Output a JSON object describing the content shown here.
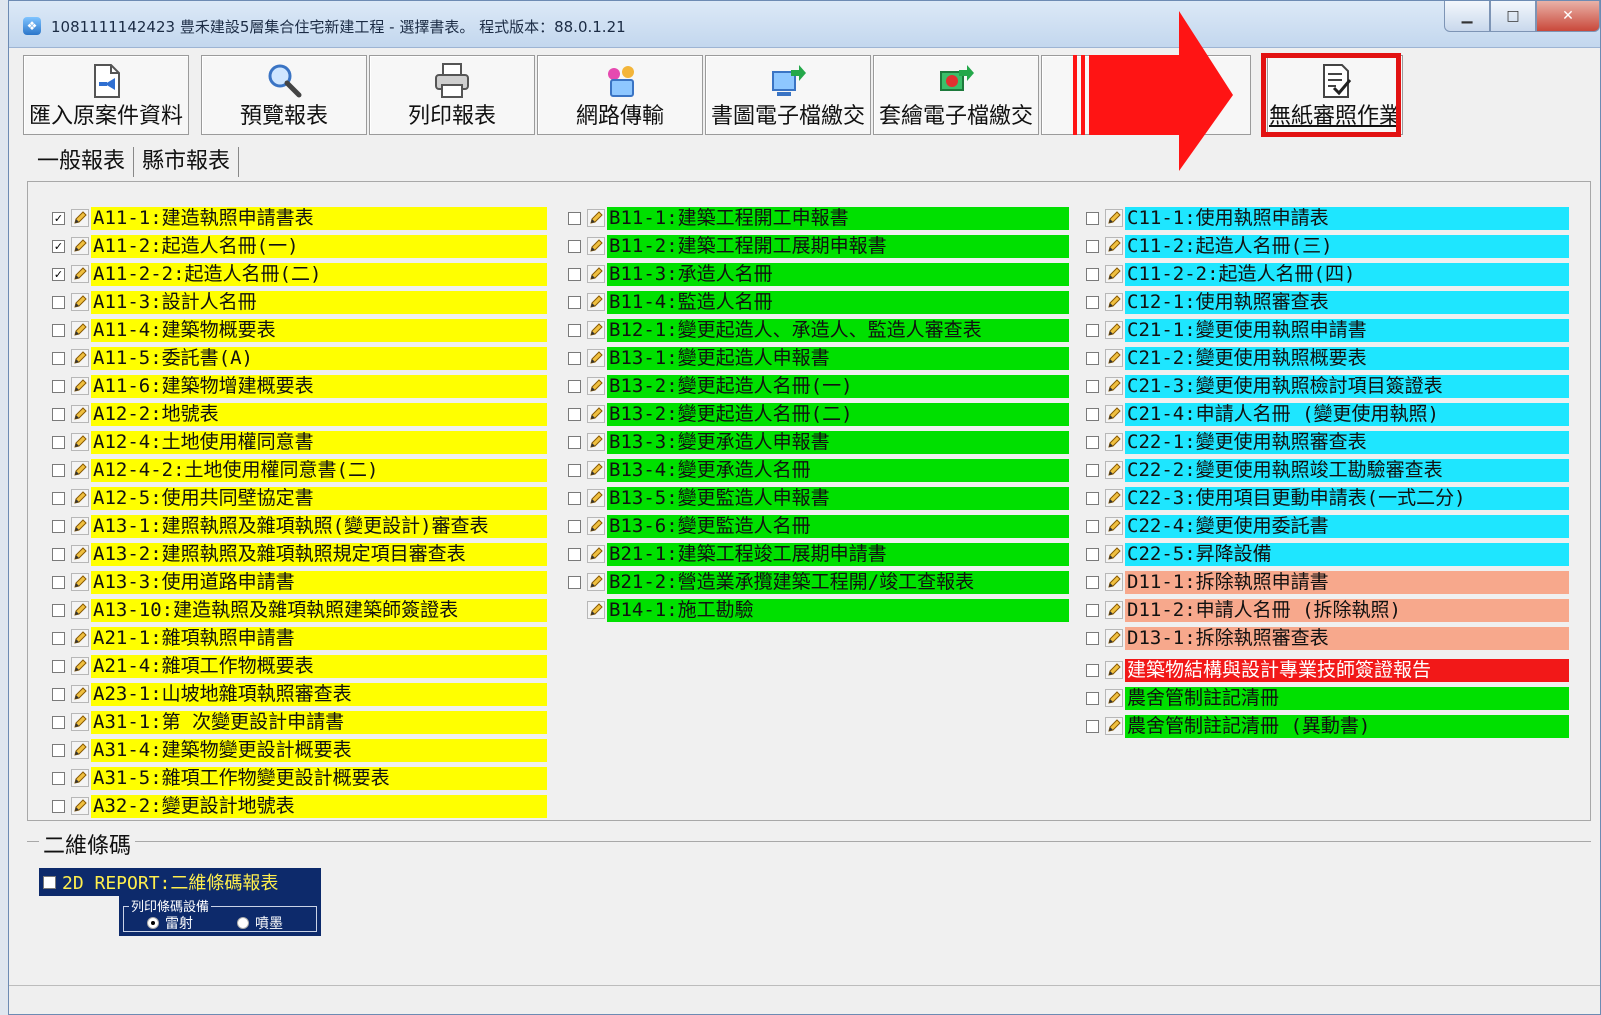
{
  "window": {
    "title": "1081111142423 豊禾建設5層集合住宅新建工程 - 選擇書表。   程式版本：88.0.1.21",
    "minimize": "▁",
    "maximize": "□",
    "close": "✕"
  },
  "toolbar": [
    {
      "label": "匯入原案件資料",
      "icon": "import-icon"
    },
    {
      "label": "預覽報表",
      "icon": "magnifier-icon"
    },
    {
      "label": "列印報表",
      "icon": "printer-icon"
    },
    {
      "label": "網路傳輸",
      "icon": "network-icon"
    },
    {
      "label": "書圖電子檔繳交",
      "icon": "upload-icon"
    },
    {
      "label": "套繪電子檔繳交",
      "icon": "upload-red-icon"
    },
    {
      "label": "無紙審照作業",
      "icon": "paper-check-icon"
    }
  ],
  "tabs": [
    "一般報表",
    "縣市報表"
  ],
  "colors": {
    "yellow": "#ffff00",
    "green": "#00e000",
    "cyan": "#1ee6ff",
    "salmon": "#f7a88c",
    "red": "#f21818",
    "highlight_red": "#e21212"
  },
  "columns": [
    [
      {
        "text": "A11-1:建造執照申請書表",
        "checked": true,
        "color": "#ffff00"
      },
      {
        "text": "A11-2:起造人名冊(一)",
        "checked": true,
        "color": "#ffff00"
      },
      {
        "text": "A11-2-2:起造人名冊(二)",
        "checked": true,
        "color": "#ffff00"
      },
      {
        "text": "A11-3:設計人名冊",
        "checked": false,
        "color": "#ffff00"
      },
      {
        "text": "A11-4:建築物概要表",
        "checked": false,
        "color": "#ffff00"
      },
      {
        "text": "A11-5:委託書(A)",
        "checked": false,
        "color": "#ffff00"
      },
      {
        "text": "A11-6:建築物增建概要表",
        "checked": false,
        "color": "#ffff00"
      },
      {
        "text": "A12-2:地號表",
        "checked": false,
        "color": "#ffff00"
      },
      {
        "text": "A12-4:土地使用權同意書",
        "checked": false,
        "color": "#ffff00"
      },
      {
        "text": "A12-4-2:土地使用權同意書(二)",
        "checked": false,
        "color": "#ffff00"
      },
      {
        "text": "A12-5:使用共同壁協定書",
        "checked": false,
        "color": "#ffff00"
      },
      {
        "text": "A13-1:建照執照及雜項執照(變更設計)審查表",
        "checked": false,
        "color": "#ffff00"
      },
      {
        "text": "A13-2:建照執照及雜項執照規定項目審查表",
        "checked": false,
        "color": "#ffff00"
      },
      {
        "text": "A13-3:使用道路申請書",
        "checked": false,
        "color": "#ffff00"
      },
      {
        "text": "A13-10:建造執照及雜項執照建築師簽證表",
        "checked": false,
        "color": "#ffff00"
      },
      {
        "text": "A21-1:雜項執照申請書",
        "checked": false,
        "color": "#ffff00"
      },
      {
        "text": "A21-4:雜項工作物概要表",
        "checked": false,
        "color": "#ffff00"
      },
      {
        "text": "A23-1:山坡地雜項執照審查表",
        "checked": false,
        "color": "#ffff00"
      },
      {
        "text": "A31-1:第 次變更設計申請書",
        "checked": false,
        "color": "#ffff00"
      },
      {
        "text": "A31-4:建築物變更設計概要表",
        "checked": false,
        "color": "#ffff00"
      },
      {
        "text": "A31-5:雜項工作物變更設計概要表",
        "checked": false,
        "color": "#ffff00"
      },
      {
        "text": "A32-2:變更設計地號表",
        "checked": false,
        "color": "#ffff00"
      }
    ],
    [
      {
        "text": "B11-1:建築工程開工申報書",
        "checked": false,
        "color": "#00e000"
      },
      {
        "text": "B11-2:建築工程開工展期申報書",
        "checked": false,
        "color": "#00e000"
      },
      {
        "text": "B11-3:承造人名冊",
        "checked": false,
        "color": "#00e000"
      },
      {
        "text": "B11-4:監造人名冊",
        "checked": false,
        "color": "#00e000"
      },
      {
        "text": "B12-1:變更起造人、承造人、監造人審查表",
        "checked": false,
        "color": "#00e000"
      },
      {
        "text": "B13-1:變更起造人申報書",
        "checked": false,
        "color": "#00e000"
      },
      {
        "text": "B13-2:變更起造人名冊(一)",
        "checked": false,
        "color": "#00e000"
      },
      {
        "text": "B13-2:變更起造人名冊(二)",
        "checked": false,
        "color": "#00e000"
      },
      {
        "text": "B13-3:變更承造人申報書",
        "checked": false,
        "color": "#00e000"
      },
      {
        "text": "B13-4:變更承造人名冊",
        "checked": false,
        "color": "#00e000"
      },
      {
        "text": "B13-5:變更監造人申報書",
        "checked": false,
        "color": "#00e000"
      },
      {
        "text": "B13-6:變更監造人名冊",
        "checked": false,
        "color": "#00e000"
      },
      {
        "text": "B21-1:建築工程竣工展期申請書",
        "checked": false,
        "color": "#00e000"
      },
      {
        "text": "B21-2:營造業承攬建築工程開/竣工查報表",
        "checked": false,
        "color": "#00e000"
      },
      {
        "text": "B14-1:施工勘驗",
        "checked": null,
        "color": "#00e000"
      }
    ],
    [
      {
        "text": "C11-1:使用執照申請表",
        "checked": false,
        "color": "#1ee6ff"
      },
      {
        "text": "C11-2:起造人名冊(三)",
        "checked": false,
        "color": "#1ee6ff"
      },
      {
        "text": "C11-2-2:起造人名冊(四)",
        "checked": false,
        "color": "#1ee6ff"
      },
      {
        "text": "C12-1:使用執照審查表",
        "checked": false,
        "color": "#1ee6ff"
      },
      {
        "text": "C21-1:變更使用執照申請書",
        "checked": false,
        "color": "#1ee6ff"
      },
      {
        "text": "C21-2:變更使用執照概要表",
        "checked": false,
        "color": "#1ee6ff"
      },
      {
        "text": "C21-3:變更使用執照檢討項目簽證表",
        "checked": false,
        "color": "#1ee6ff"
      },
      {
        "text": "C21-4:申請人名冊 (變更使用執照)",
        "checked": false,
        "color": "#1ee6ff"
      },
      {
        "text": "C22-1:變更使用執照審查表",
        "checked": false,
        "color": "#1ee6ff"
      },
      {
        "text": "C22-2:變更使用執照竣工勘驗審查表",
        "checked": false,
        "color": "#1ee6ff"
      },
      {
        "text": "C22-3:使用項目更動申請表(一式二分)",
        "checked": false,
        "color": "#1ee6ff"
      },
      {
        "text": "C22-4:變更使用委託書",
        "checked": false,
        "color": "#1ee6ff"
      },
      {
        "text": "C22-5:昇降設備",
        "checked": false,
        "color": "#1ee6ff"
      },
      {
        "text": "D11-1:拆除執照申請書",
        "checked": false,
        "color": "#f7a88c"
      },
      {
        "text": "D11-2:申請人名冊 (拆除執照)",
        "checked": false,
        "color": "#f7a88c"
      },
      {
        "text": "D13-1:拆除執照審查表",
        "checked": false,
        "color": "#f7a88c"
      },
      {
        "text": "建築物結構與設計專業技師簽證報告",
        "checked": false,
        "color": "#f21818",
        "text_color": "#ffffff",
        "gap_before": true
      },
      {
        "text": "農舍管制註記清冊",
        "checked": false,
        "color": "#00e000"
      },
      {
        "text": "農舍管制註記清冊 (異動書)",
        "checked": false,
        "color": "#00e000"
      }
    ]
  ],
  "qrcode": {
    "section_title": "二維條碼",
    "item_label": "2D REPORT:二維條碼報表",
    "device_title": "列印條碼設備",
    "options": [
      "雷射",
      "噴墨"
    ],
    "selected": 0
  }
}
